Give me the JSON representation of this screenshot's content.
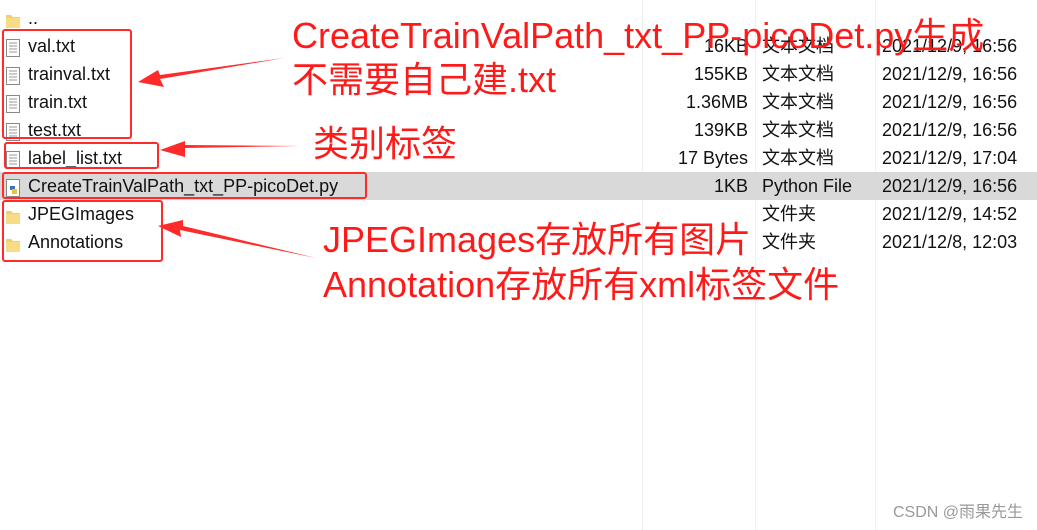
{
  "files": [
    {
      "name": "..",
      "size": "",
      "type": "",
      "date": "",
      "icon": "folder-icon"
    },
    {
      "name": "val.txt",
      "size": "16KB",
      "type": "文本文档",
      "date": "2021/12/9, 16:56",
      "icon": "text-file-icon"
    },
    {
      "name": "trainval.txt",
      "size": "155KB",
      "type": "文本文档",
      "date": "2021/12/9, 16:56",
      "icon": "text-file-icon"
    },
    {
      "name": "train.txt",
      "size": "1.36MB",
      "type": "文本文档",
      "date": "2021/12/9, 16:56",
      "icon": "text-file-icon"
    },
    {
      "name": "test.txt",
      "size": "139KB",
      "type": "文本文档",
      "date": "2021/12/9, 16:56",
      "icon": "text-file-icon"
    },
    {
      "name": "label_list.txt",
      "size": "17 Bytes",
      "type": "文本文档",
      "date": "2021/12/9, 17:04",
      "icon": "text-file-icon"
    },
    {
      "name": "CreateTrainValPath_txt_PP-picoDet.py",
      "size": "1KB",
      "type": "Python File",
      "date": "2021/12/9, 16:56",
      "icon": "python-file-icon",
      "selected": true
    },
    {
      "name": "JPEGImages",
      "size": "",
      "type": "文件夹",
      "date": "2021/12/9, 14:52",
      "icon": "folder-icon"
    },
    {
      "name": "Annotations",
      "size": "",
      "type": "文件夹",
      "date": "2021/12/8, 12:03",
      "icon": "folder-icon"
    }
  ],
  "annotations": {
    "note1_line1": "CreateTrainValPath_txt_PP-picoDet.py生成",
    "note1_line2": "不需要自己建.txt",
    "note2": "类别标签",
    "note3_line1": "JPEGImages存放所有图片",
    "note3_line2": "Annotation存放所有xml标签文件",
    "color": "#ff1a1a"
  },
  "watermark": "CSDN @雨果先生"
}
